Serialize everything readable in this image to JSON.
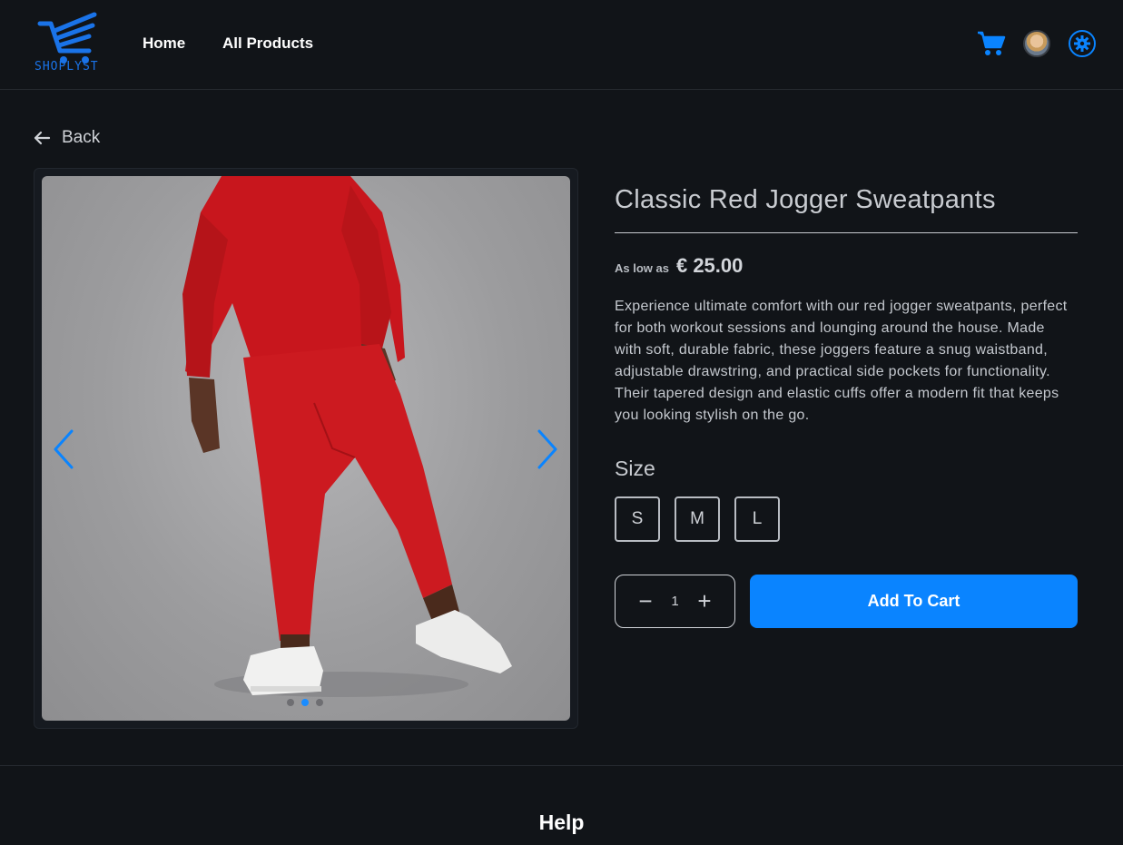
{
  "brand": {
    "name": "SHOPLYST",
    "accent": "#0a84ff"
  },
  "header": {
    "nav": [
      {
        "label": "Home"
      },
      {
        "label": "All Products"
      }
    ],
    "icons": [
      "cart-icon",
      "avatar",
      "settings-icon"
    ]
  },
  "back": {
    "label": "Back"
  },
  "gallery": {
    "current_index": 2,
    "total": 3,
    "image_description_icon": "product-photo"
  },
  "product": {
    "title": "Classic Red Jogger Sweatpants",
    "price_prefix": "As low as",
    "price": "€ 25.00",
    "description": "Experience ultimate comfort with our red jogger sweatpants, perfect for both workout sessions and lounging around the house. Made with soft, durable fabric, these joggers feature a snug waistband, adjustable drawstring, and practical side pockets for functionality. Their tapered design and elastic cuffs offer a modern fit that keeps you looking stylish on the go.",
    "size_label": "Size",
    "sizes": [
      "S",
      "M",
      "L"
    ],
    "quantity": "1",
    "quantity_decrement": "−",
    "quantity_increment": "+",
    "add_to_cart": "Add To Cart"
  },
  "footer": {
    "heading": "Help"
  }
}
